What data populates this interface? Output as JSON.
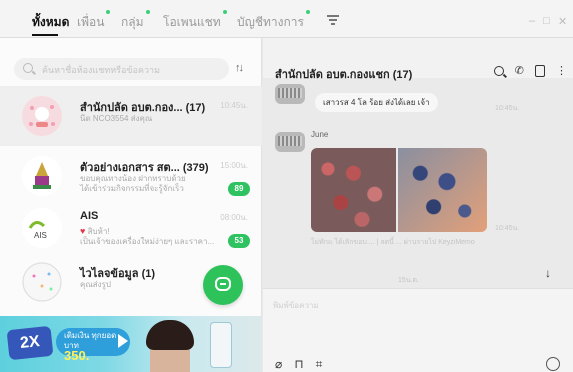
{
  "tabs": [
    {
      "label": "ทั้งหมด",
      "active": true
    },
    {
      "label": "เพื่อน",
      "active": false
    },
    {
      "label": "กลุ่ม",
      "active": false
    },
    {
      "label": "โอเพนแชท",
      "active": false
    },
    {
      "label": "บัญชีทางการ",
      "active": false
    }
  ],
  "search": {
    "placeholder": "ค้นหาชื่อห้องแชทหรือข้อความ"
  },
  "chats": [
    {
      "name": "สำนักปลัด อบต.กอง... (17)",
      "preview": "นีด NCO3554 ส่งคุณ",
      "time": "10:45น."
    },
    {
      "name": "ตัวอย่างเอกสาร สต... (379)",
      "preview": "ขอบคุณทางน้อง ฝากทราบด้วย",
      "preview2": "ได้เข้าร่วมกิจกรรมที่จะรู้จักเร็ว",
      "time": "15:00น.",
      "badge": "89"
    },
    {
      "name": "AIS",
      "heart": "♥",
      "preview": "สิบห้า!",
      "preview2": "เป็นเจ้าของเครื่องใหม่ง่ายๆ และราคา...",
      "time": "08:00น.",
      "badge": "53"
    },
    {
      "name": "ไวไลจข้อมูล (1)",
      "preview": "คุณส่งรูป"
    }
  ],
  "banner": {
    "multiplier": "2X",
    "pill_top": "เติมเงิน ทุกยอดบาท",
    "pill_amount": "350."
  },
  "chat_header": {
    "title": "สำนักปลัด อบต.กองแชก (17)"
  },
  "messages": {
    "bubble_text": "เสาวรส 4 โล ร้อย ส่งได้เลย เจ้า",
    "bubble_time": "10:45น.",
    "sender": "June",
    "photo_time": "10:45น.",
    "photo_caption": "ไม่ทักแ ได้เลิกขอบ.... | ลดนี้ ... ผ่านรายไป KeyziMemo",
    "date_divider": "15น.ต."
  },
  "composer": {
    "placeholder": "พิมพ์ข้อความ"
  },
  "colors": {
    "accent_green": "#2fc260",
    "badge_green": "#2fc260",
    "banner_blue": "#3557b9"
  }
}
